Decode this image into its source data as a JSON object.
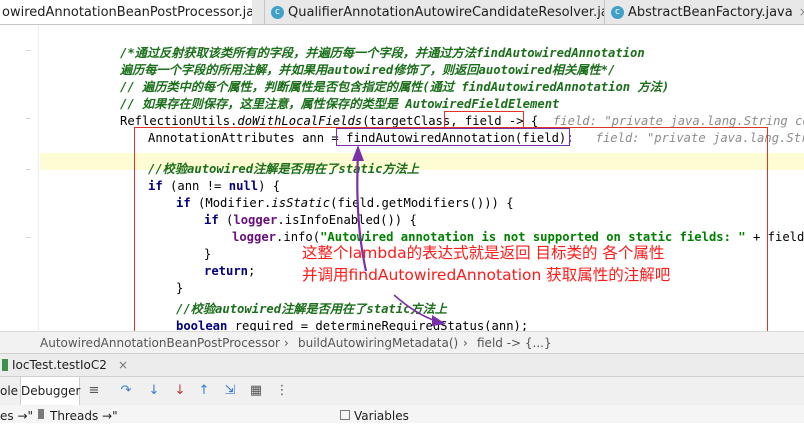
{
  "editor_tabs": [
    {
      "label": "owiredAnnotationBeanPostProcessor.java",
      "active": true
    },
    {
      "label": "QualifierAnnotationAutowireCandidateResolver.java",
      "active": false
    },
    {
      "label": "AbstractBeanFactory.java",
      "active": false
    }
  ],
  "tab_close_glyph": "×",
  "class_icon_letter": "c",
  "code": {
    "comment1a": "/*通过反射获取该类所有的字段，并遍历每一个字段，并通过方法",
    "comment1b": "findAutowiredAnnotation",
    "comment2": "遍历每一个字段的所用注解，并如果用autowired修饰了，则返回auotowired相关属性*/",
    "comment3": "// 遍历类中的每个属性，判断属性是否包含指定的属性(通过 findAutowiredAnnotation 方法)",
    "comment4": "// 如果存在则保存，这里注意，属性保存的类型是 AutowiredFieldElement",
    "l5_prefix": "ReflectionUtils.",
    "l5_method": "doWithLocalFields",
    "l5_args": "(targetClass, ",
    "l5_lambda": "field -> {",
    "l5_hint": "field: \"private java.lang.String com.sh",
    "l6_type": "AnnotationAttributes ann = ",
    "l6_call": "findAutowiredAnnotation(field);",
    "l6_hint": "field: \"private java.lang.String c",
    "comment7": "//校验autowired注解是否用在了static方法上",
    "l8_if": "if",
    "l8_rest": " (ann != ",
    "l8_null": "null",
    "l8_end": ") {",
    "l9_if": "if",
    "l9_open": " (Modifier.",
    "l9_static": "isStatic",
    "l9_rest": "(field.getModifiers())) {",
    "l10_if": "if",
    "l10_open": " (",
    "l10_logger": "logger",
    "l10_rest": ".isInfoEnabled()) {",
    "l11_logger": "logger",
    "l11_info": ".info(",
    "l11_str": "\"Autowired annotation is not supported on static fields: \"",
    "l11_rest": " + field);",
    "l12": "}",
    "l13_return": "return",
    "l13_semi": ";",
    "l14": "}",
    "comment15": "//校验autowired注解是否用在了static方法上",
    "l16_kw": "boolean",
    "l16_rest": " required = determineRequiredStatus(ann);"
  },
  "annotation": {
    "line1": "这整个lambda的表达式就是返回 目标类的 各个属性",
    "line2": "并调用findAutowiredAnnotation 获取属性的注解吧",
    "color": "#ff1a1a"
  },
  "breadcrumb": [
    "AutowiredAnnotationBeanPostProcessor",
    "buildAutowiringMetadata()",
    "field -> {...}"
  ],
  "breadcrumb_sep": "›",
  "run_config": {
    "label": "IocTest.testIoC2",
    "close": "×"
  },
  "debug_tabs": [
    "ole",
    "Debugger"
  ],
  "bottom_tabs": [
    "es →\"",
    "Threads →\"",
    "Variables"
  ],
  "colors": {
    "red_box": "#e0332a",
    "purple_box": "#7b2fa8",
    "arrow": "#7b2fa8",
    "highlight": "#fdfcd2"
  }
}
